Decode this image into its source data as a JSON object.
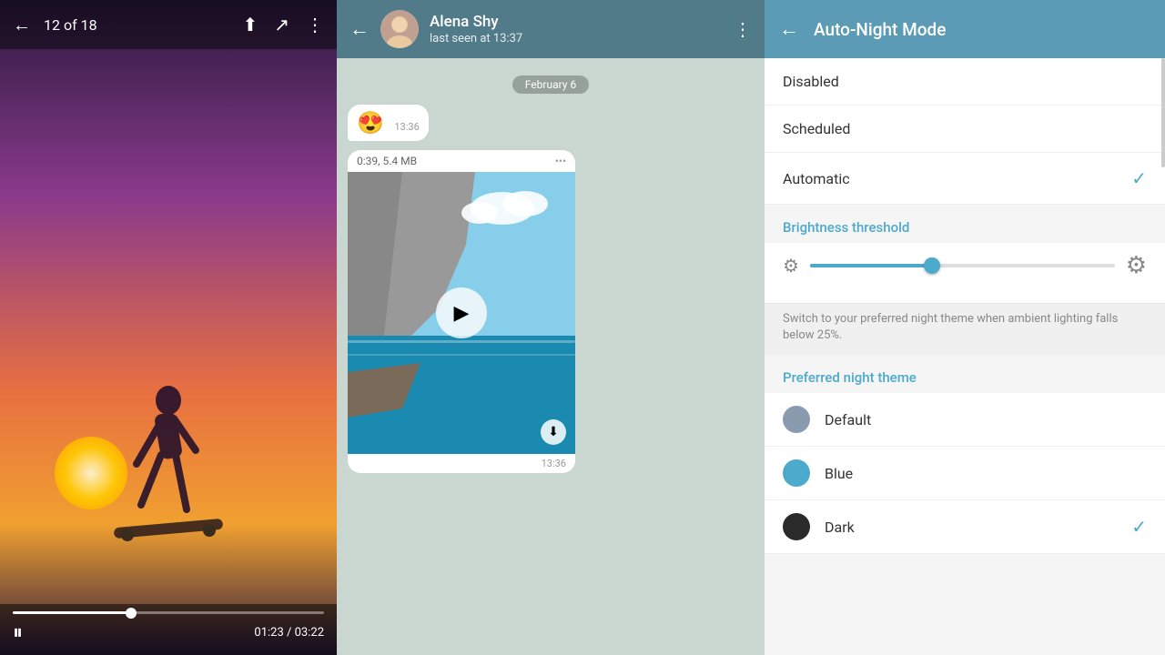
{
  "video_panel": {
    "counter": "12 of 18",
    "time_current": "01:23",
    "time_total": "03:22",
    "progress_percent": 38
  },
  "chat_panel": {
    "header": {
      "back_label": "←",
      "name": "Alena Shy",
      "status": "last seen at 13:37",
      "more_label": "⋮"
    },
    "date_badge": "February 6",
    "messages": [
      {
        "type": "emoji",
        "content": "😍",
        "time": "13:36"
      },
      {
        "type": "video",
        "meta": "0:39, 5.4 MB",
        "time": "13:36"
      }
    ]
  },
  "settings_panel": {
    "header": {
      "back_label": "←",
      "title": "Auto-Night Mode"
    },
    "options": [
      {
        "label": "Disabled",
        "selected": false
      },
      {
        "label": "Scheduled",
        "selected": false
      },
      {
        "label": "Automatic",
        "selected": true
      }
    ],
    "brightness": {
      "section_label": "Brightness threshold",
      "hint": "Switch to your preferred night theme when ambient lighting falls below 25%.",
      "value": 40
    },
    "preferred_theme": {
      "section_label": "Preferred night theme",
      "options": [
        {
          "label": "Default",
          "color": "default",
          "selected": false
        },
        {
          "label": "Blue",
          "color": "blue",
          "selected": false
        },
        {
          "label": "Dark",
          "color": "dark",
          "selected": true
        }
      ]
    }
  }
}
